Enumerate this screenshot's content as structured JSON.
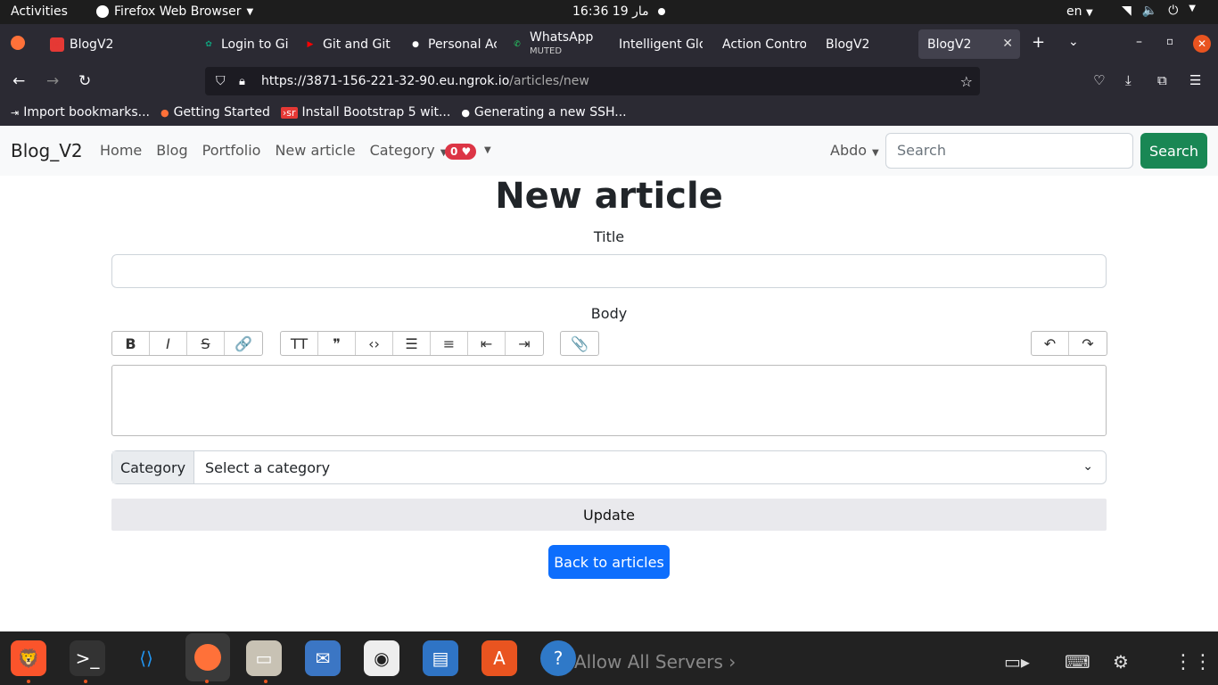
{
  "system": {
    "activities": "Activities",
    "app_name": "Firefox Web Browser",
    "clock": "16:36  19 مار",
    "lang": "en",
    "sys_icons": [
      "wifi-icon",
      "volume-icon",
      "power-icon"
    ]
  },
  "tabs": [
    {
      "label": "BlogV2",
      "icon": "sr-icon",
      "color": "#e53935"
    },
    {
      "label": "Login to Gi",
      "icon": "chatgpt-icon",
      "color": "#10a37f"
    },
    {
      "label": "Git and Git",
      "icon": "youtube-icon",
      "color": "#ff0000"
    },
    {
      "label": "Personal Ac",
      "icon": "github-icon",
      "color": "#ffffff"
    },
    {
      "label": "WhatsApp",
      "sub": "MUTED",
      "icon": "whatsapp-icon",
      "color": "#25d366"
    },
    {
      "label": "Intelligent Glo",
      "icon": "",
      "color": ""
    },
    {
      "label": "Action Contro",
      "icon": "",
      "color": ""
    },
    {
      "label": "BlogV2",
      "icon": "",
      "color": ""
    },
    {
      "label": "BlogV2",
      "icon": "",
      "color": "",
      "active": true
    }
  ],
  "browser": {
    "url_host": "https://3871-156-221-32-90.eu.ngrok.io",
    "url_path": "/articles/new"
  },
  "bookmarks": [
    {
      "label": "Import bookmarks...",
      "icon": "import-icon"
    },
    {
      "label": "Getting Started",
      "icon": "firefox-icon"
    },
    {
      "label": "Install Bootstrap 5 wit...",
      "icon": "sr-icon"
    },
    {
      "label": "Generating a new SSH...",
      "icon": "github-icon"
    }
  ],
  "site_nav": {
    "brand": "Blog_V2",
    "links": [
      "Home",
      "Blog",
      "Portfolio",
      "New article",
      "Category"
    ],
    "badge": "0",
    "user": "Abdo",
    "search_placeholder": "Search",
    "search_button": "Search"
  },
  "form": {
    "heading": "New article",
    "title_label": "Title",
    "body_label": "Body",
    "category_prefix": "Category",
    "category_selected": "Select a category",
    "submit": "Update",
    "back": "Back to articles"
  },
  "toolbar": {
    "group1": [
      {
        "g": "B",
        "n": "bold-icon"
      },
      {
        "g": "I",
        "n": "italic-icon"
      },
      {
        "g": "S",
        "n": "strike-icon"
      },
      {
        "g": "🔗",
        "n": "link-icon"
      }
    ],
    "group2": [
      {
        "g": "TT",
        "n": "heading-icon"
      },
      {
        "g": "❞",
        "n": "quote-icon"
      },
      {
        "g": "‹›",
        "n": "code-icon"
      },
      {
        "g": "☰",
        "n": "bullet-list-icon"
      },
      {
        "g": "≡",
        "n": "numbered-list-icon"
      },
      {
        "g": "⇤",
        "n": "outdent-icon"
      },
      {
        "g": "⇥",
        "n": "indent-icon"
      }
    ],
    "group3": [
      {
        "g": "📎",
        "n": "attach-icon"
      }
    ],
    "group4": [
      {
        "g": "↶",
        "n": "undo-icon"
      },
      {
        "g": "↷",
        "n": "redo-icon"
      }
    ]
  },
  "dock": {
    "background_text": "Allow All Servers ›"
  }
}
